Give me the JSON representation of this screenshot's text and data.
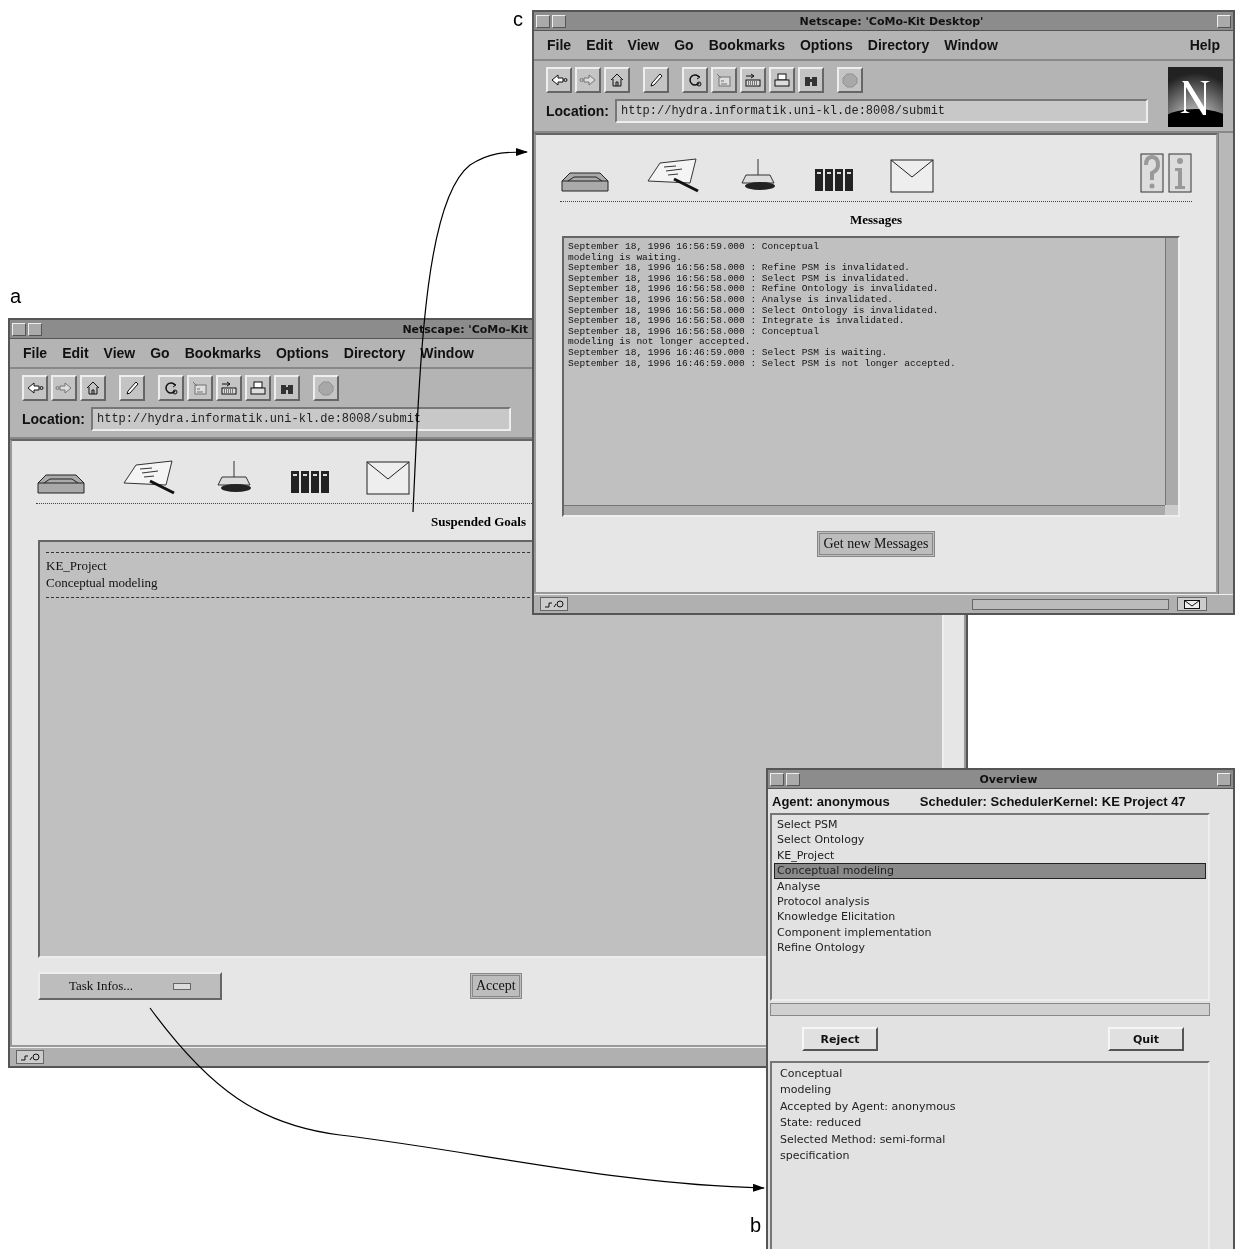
{
  "goals_window": {
    "label": "a",
    "title": "Netscape: 'CoMo-Kit",
    "menu": [
      "File",
      "Edit",
      "View",
      "Go",
      "Bookmarks",
      "Options",
      "Directory",
      "Window"
    ],
    "toolbar": [
      {
        "kind": "back",
        "disabled": false
      },
      {
        "kind": "forward",
        "disabled": true
      },
      {
        "kind": "home",
        "disabled": false
      },
      {
        "kind": "edit",
        "disabled": false
      },
      {
        "kind": "reload",
        "disabled": false
      },
      {
        "kind": "images",
        "disabled": true
      },
      {
        "kind": "open",
        "disabled": false
      },
      {
        "kind": "print",
        "disabled": false
      },
      {
        "kind": "find",
        "disabled": false
      },
      {
        "kind": "stop",
        "disabled": true
      }
    ],
    "location_label": "Location:",
    "url": "http://hydra.informatik.uni-kl.de:8008/submit",
    "heading": "Suspended Goals",
    "goals": [
      "KE_Project",
      "Conceptual modeling"
    ],
    "task_menu": "Task Infos...",
    "accept_button": "Accept"
  },
  "messages_window": {
    "label": "c",
    "title": "Netscape: 'CoMo-Kit Desktop'",
    "menu": [
      "File",
      "Edit",
      "View",
      "Go",
      "Bookmarks",
      "Options",
      "Directory",
      "Window"
    ],
    "help_menu": "Help",
    "toolbar": [
      {
        "kind": "back",
        "disabled": false
      },
      {
        "kind": "forward",
        "disabled": true
      },
      {
        "kind": "home",
        "disabled": false
      },
      {
        "kind": "edit",
        "disabled": false
      },
      {
        "kind": "reload",
        "disabled": false
      },
      {
        "kind": "images",
        "disabled": true
      },
      {
        "kind": "open",
        "disabled": false
      },
      {
        "kind": "print",
        "disabled": false
      },
      {
        "kind": "find",
        "disabled": false
      },
      {
        "kind": "stop",
        "disabled": true
      }
    ],
    "location_label": "Location:",
    "url": "http://hydra.informatik.uni-kl.de:8008/submit",
    "heading": "Messages",
    "messages": [
      "September 18, 1996 16:56:59.000 : Conceptual",
      "modeling is waiting.",
      "September 18, 1996 16:56:58.000 : Refine PSM is invalidated.",
      "September 18, 1996 16:56:58.000 : Select PSM is invalidated.",
      "September 18, 1996 16:56:58.000 : Refine Ontology is invalidated.",
      "September 18, 1996 16:56:58.000 : Analyse is invalidated.",
      "September 18, 1996 16:56:58.000 : Select Ontology is invalidated.",
      "September 18, 1996 16:56:58.000 : Integrate is invalidated.",
      "September 18, 1996 16:56:58.000 : Conceptual",
      "modeling is not longer accepted.",
      "September 18, 1996 16:46:59.000 : Select PSM is waiting.",
      "September 18, 1996 16:46:59.000 : Select PSM is not longer accepted."
    ],
    "button": "Get new Messages",
    "status_progress": {
      "level": 0
    }
  },
  "overview_window": {
    "label": "b",
    "title": "Overview",
    "agent": "Agent: anonymous",
    "scheduler": "Scheduler: SchedulerKernel: KE Project 47",
    "tasks": [
      {
        "name": "Select PSM",
        "selected": false
      },
      {
        "name": "Select Ontology",
        "selected": false
      },
      {
        "name": "KE_Project",
        "selected": false
      },
      {
        "name": "Conceptual modeling",
        "selected": true
      },
      {
        "name": "Analyse",
        "selected": false
      },
      {
        "name": "Protocol analysis",
        "selected": false
      },
      {
        "name": "Knowledge Elicitation",
        "selected": false
      },
      {
        "name": "Component implementation",
        "selected": false
      },
      {
        "name": "Refine Ontology",
        "selected": false
      }
    ],
    "reject_button": "Reject",
    "quit_button": "Quit",
    "details": [
      "Conceptual",
      "modeling",
      "Accepted by Agent: anonymous",
      "State: reduced",
      "Selected Method: semi-formal",
      "specification"
    ]
  }
}
